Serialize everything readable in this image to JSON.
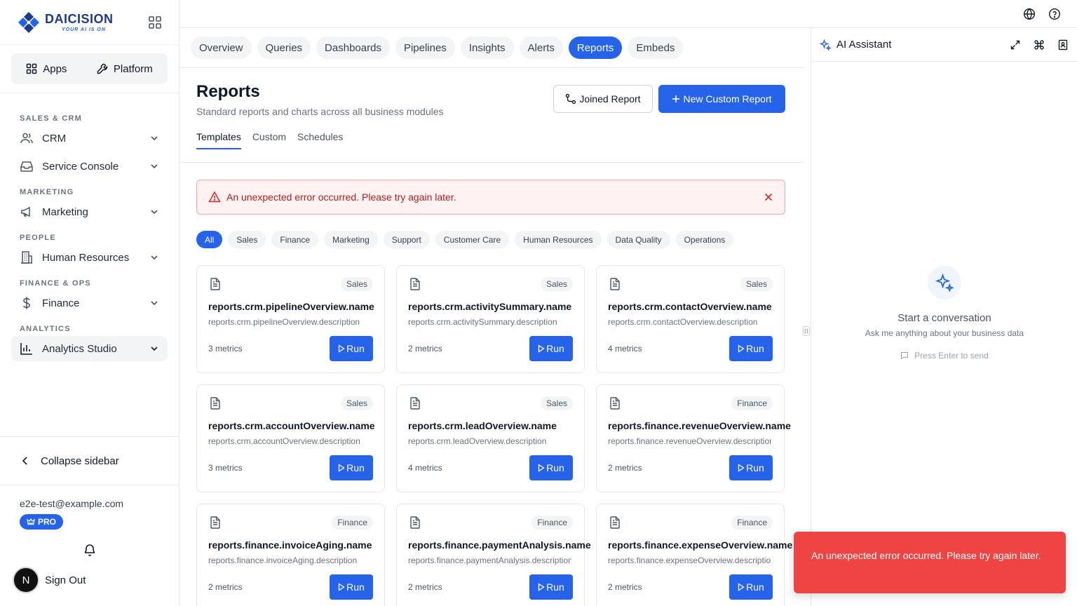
{
  "brand": {
    "name": "DAICISION",
    "tagline": "YOUR AI IS ON"
  },
  "sidebar": {
    "apps_label": "Apps",
    "platform_label": "Platform",
    "sections": [
      {
        "title": "SALES & CRM",
        "items": [
          {
            "label": "CRM",
            "icon": "users-icon"
          },
          {
            "label": "Service Console",
            "icon": "inbox-icon"
          }
        ]
      },
      {
        "title": "MARKETING",
        "items": [
          {
            "label": "Marketing",
            "icon": "megaphone-icon"
          }
        ]
      },
      {
        "title": "PEOPLE",
        "items": [
          {
            "label": "Human Resources",
            "icon": "building-icon"
          }
        ]
      },
      {
        "title": "FINANCE & OPS",
        "items": [
          {
            "label": "Finance",
            "icon": "dollar-icon"
          }
        ]
      },
      {
        "title": "ANALYTICS",
        "items": [
          {
            "label": "Analytics Studio",
            "icon": "bar-chart-icon",
            "active": true
          }
        ]
      }
    ],
    "collapse_label": "Collapse sidebar",
    "user_email": "e2e-test@example.com",
    "plan_badge": "PRO",
    "avatar_initial": "N",
    "signout_label": "Sign Out"
  },
  "main": {
    "tabs": [
      "Overview",
      "Queries",
      "Dashboards",
      "Pipelines",
      "Insights",
      "Alerts",
      "Reports",
      "Embeds"
    ],
    "active_tab": "Reports",
    "title": "Reports",
    "subtitle": "Standard reports and charts across all business modules",
    "joined_report_label": "Joined Report",
    "new_report_label": "New Custom Report",
    "subtabs": [
      "Templates",
      "Custom",
      "Schedules"
    ],
    "active_subtab": "Templates",
    "error_message": "An unexpected error occurred. Please try again later.",
    "filters": [
      "All",
      "Sales",
      "Finance",
      "Marketing",
      "Support",
      "Customer Care",
      "Human Resources",
      "Data Quality",
      "Operations"
    ],
    "active_filter": "All",
    "run_label": "Run",
    "cards": [
      {
        "category": "Sales",
        "name": "reports.crm.pipelineOverview.name",
        "description": "reports.crm.pipelineOverview.description",
        "metrics": "3 metrics"
      },
      {
        "category": "Sales",
        "name": "reports.crm.activitySummary.name",
        "description": "reports.crm.activitySummary.description",
        "metrics": "2 metrics"
      },
      {
        "category": "Sales",
        "name": "reports.crm.contactOverview.name",
        "description": "reports.crm.contactOverview.description",
        "metrics": "4 metrics"
      },
      {
        "category": "Sales",
        "name": "reports.crm.accountOverview.name",
        "description": "reports.crm.accountOverview.description",
        "metrics": "3 metrics"
      },
      {
        "category": "Sales",
        "name": "reports.crm.leadOverview.name",
        "description": "reports.crm.leadOverview.description",
        "metrics": "4 metrics"
      },
      {
        "category": "Finance",
        "name": "reports.finance.revenueOverview.name",
        "description": "reports.finance.revenueOverview.description",
        "metrics": "2 metrics"
      },
      {
        "category": "Finance",
        "name": "reports.finance.invoiceAging.name",
        "description": "reports.finance.invoiceAging.description",
        "metrics": "2 metrics"
      },
      {
        "category": "Finance",
        "name": "reports.finance.paymentAnalysis.name",
        "description": "reports.finance.paymentAnalysis.description",
        "metrics": "2 metrics"
      },
      {
        "category": "Finance",
        "name": "reports.finance.expenseOverview.name",
        "description": "reports.finance.expenseOverview.description",
        "metrics": "2 metrics"
      }
    ]
  },
  "assistant": {
    "title": "AI Assistant",
    "empty_title": "Start a conversation",
    "empty_subtitle": "Ask me anything about your business data",
    "hint": "Press Enter to send"
  },
  "toast": {
    "message": "An unexpected error occurred. Please try again later."
  },
  "colors": {
    "accent": "#2563eb",
    "error": "#ef4444",
    "error_bg": "#fef2f2"
  }
}
